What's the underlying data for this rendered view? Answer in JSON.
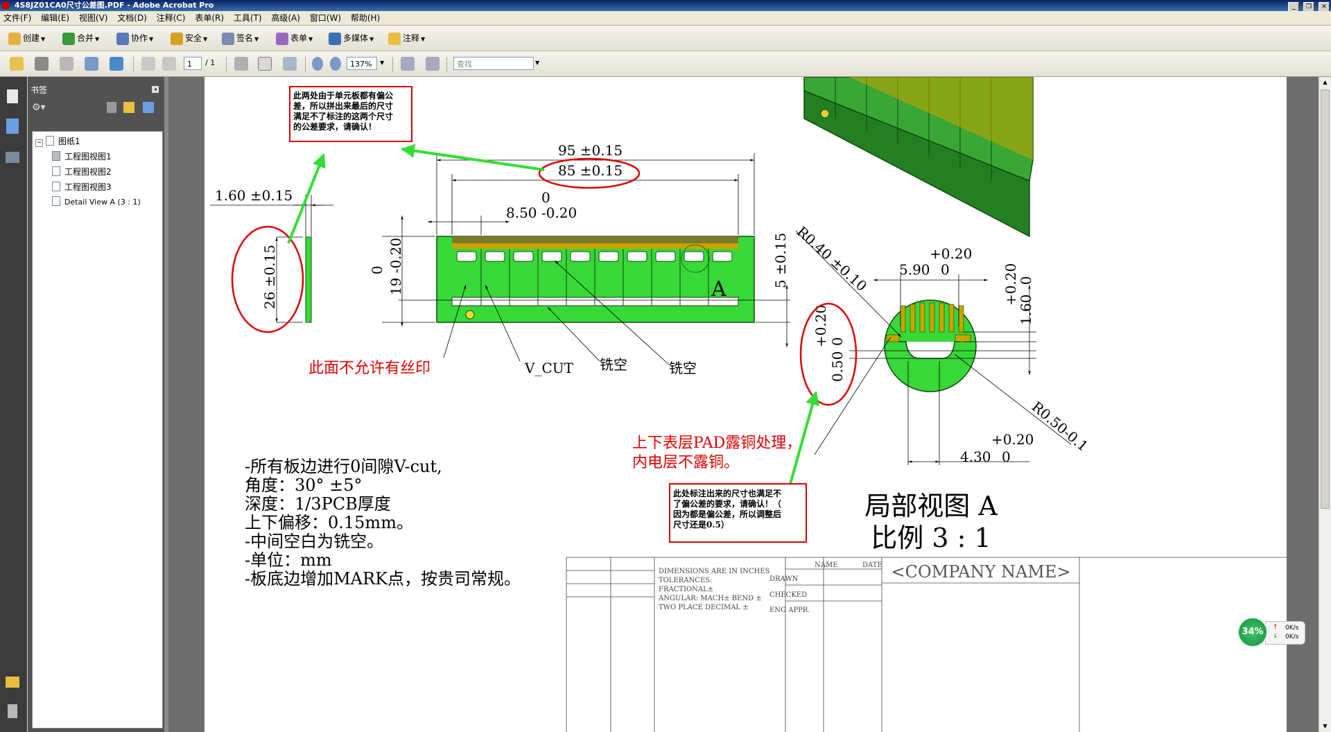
{
  "window": {
    "title": "4S8JZ01CA0尺寸公差图.PDF - Adobe Acrobat Pro"
  },
  "menu": [
    "文件(F)",
    "编辑(E)",
    "视图(V)",
    "文档(D)",
    "注释(C)",
    "表单(R)",
    "工具(T)",
    "高级(A)",
    "窗口(W)",
    "帮助(H)"
  ],
  "toolbar": {
    "create": "创建",
    "combine": "合并",
    "collaborate": "协作",
    "secure": "安全",
    "sign": "签名",
    "forms": "表单",
    "multimedia": "多媒体",
    "comment": "注释"
  },
  "nav": {
    "page_current": "1",
    "page_total": "/ 1",
    "zoom": "137%",
    "find_placeholder": "查找"
  },
  "bookmarks": {
    "header": "书签",
    "tree": [
      {
        "label": "图纸1"
      },
      {
        "label": "工程图视图1"
      },
      {
        "label": "工程图视图2"
      },
      {
        "label": "工程图视图3"
      },
      {
        "label": "Detail View A (3 : 1)"
      }
    ]
  },
  "drawing": {
    "callout_top": [
      "此两处由于单元板都有偏公",
      "差，所以拼出来最后的尺寸",
      "满足不了标注的这两个尺寸",
      "的公差要求，请确认！"
    ],
    "callout_bottom": [
      "此处标注出来的尺寸也满足不",
      "了偏公差的要求，请确认！（",
      "因为都是偏公差，所以调整后",
      "尺寸还是0.5）"
    ],
    "dims": {
      "d95": "95 ±0.15",
      "d85": "85 ±0.15",
      "d0": "0",
      "d850": "8.50 -0.20",
      "d160": "1.60 ±0.15",
      "d26": "26 ±0.15",
      "d19": "19 -0.20",
      "d19zero": "0",
      "d5": "5 ±0.15",
      "r040": "R0.40 ±0.10",
      "r050": "R0.50-0.1",
      "d590": "5.90",
      "d590zero": "0",
      "d590plus": "+0.20",
      "d160v": "1.60",
      "d160vzero": "0",
      "d160vplus": "+0.20",
      "d050": "0.50",
      "d050zero": "0",
      "d050plus": "+0.20",
      "d430": "4.30",
      "d430zero": "0",
      "d430plus": "+0.20"
    },
    "labels": {
      "no_silkscreen": "此面不允许有丝印",
      "vcut": "V_CUT",
      "milled1": "铣空",
      "milled2": "铣空",
      "pad_note1": "上下表层PAD露铜处理，",
      "pad_note2": "内电层不露铜。",
      "detail_a": "A",
      "view_title": "局部视图 A",
      "scale": "比例 3 : 1"
    },
    "notes": [
      "-所有板边进行0间隙V-cut,",
      "角度：30°  ±5°",
      "深度：1/3PCB厚度",
      "上下偏移：0.15mm。",
      "-中间空白为铣空。",
      "-单位：mm",
      "-板底边增加MARK点，按贵司常规。"
    ],
    "titleblock": {
      "dims_in_inches": "DIMENSIONS ARE IN INCHES",
      "tolerances": "TOLERANCES:",
      "fractional": "FRACTIONAL±",
      "angular": "ANGULAR: MACH±    BEND ±",
      "two_place": "TWO PLACE DECIMAL    ±",
      "name": "NAME",
      "date": "DATE",
      "drawn": "DRAWN",
      "checked": "CHECKED",
      "eng_appr": "ENG APPR.",
      "company": "<COMPANY NAME>"
    }
  },
  "netmeter": {
    "percent": "34%",
    "up": "0K/s",
    "down": "0K/s"
  }
}
